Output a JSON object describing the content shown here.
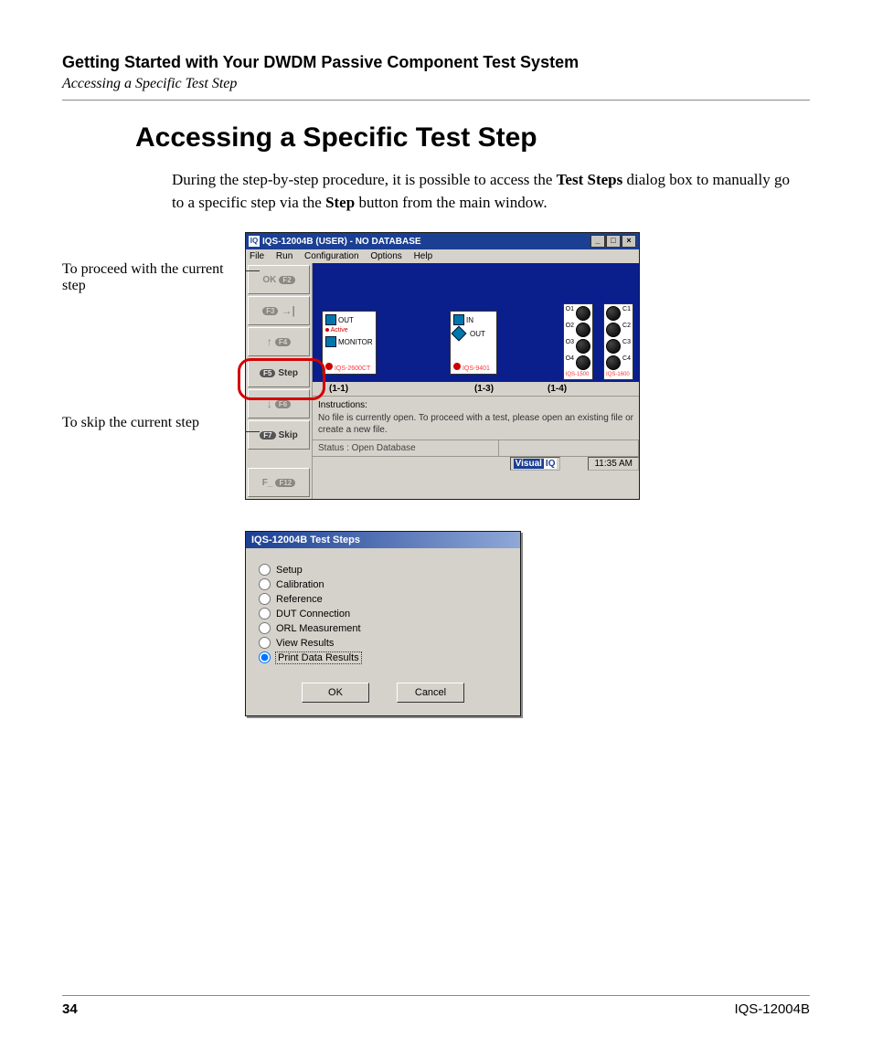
{
  "header": {
    "running_title": "Getting Started with Your DWDM Passive Component Test System",
    "running_sub": "Accessing a Specific Test Step"
  },
  "heading": "Accessing a Specific Test Step",
  "body": {
    "p1_a": "During the step-by-step procedure, it is possible to access the ",
    "p1_b": "Test Steps",
    "p1_c": " dialog box to manually go to a specific step via the ",
    "p1_d": "Step",
    "p1_e": " button from the main window."
  },
  "callout": {
    "proceed": "To proceed with the current step",
    "skip": "To skip the current step"
  },
  "app": {
    "title": "IQS-12004B (USER) - NO DATABASE",
    "menu": {
      "file": "File",
      "run": "Run",
      "config": "Configuration",
      "options": "Options",
      "help": "Help"
    },
    "side": {
      "ok": "OK",
      "f2": "F2",
      "f3": "F3",
      "f4": "F4",
      "step": "Step",
      "f5": "F5",
      "f6": "F6",
      "skip": "Skip",
      "f7": "F7",
      "fblank": "F_",
      "f12": "F12"
    },
    "module1": {
      "out": "OUT",
      "active": "Active",
      "monitor": "MONITOR",
      "foot": "IQS-2600CT"
    },
    "module2": {
      "in": "IN",
      "out": "OUT",
      "foot": "IQS-9401"
    },
    "knobs1": {
      "o1": "O1",
      "o2": "O2",
      "o3": "O3",
      "o4": "O4",
      "foot": "IQS-1500"
    },
    "knobs2": {
      "c1": "C1",
      "c2": "C2",
      "c3": "C3",
      "c4": "C4",
      "foot": "IQS-1600"
    },
    "slots": {
      "s1": "(1-1)",
      "s3": "(1-3)",
      "s4": "(1-4)"
    },
    "instructions": {
      "label": "Instructions:",
      "text": "No file is currently open. To proceed with a test, please open an existing file or create a new file."
    },
    "status": {
      "label": "Status : Open Database"
    },
    "brand": {
      "visual": "Visual",
      "iq": "IQ"
    },
    "time": "11:35 AM"
  },
  "dialog": {
    "title": "IQS-12004B Test Steps",
    "opts": {
      "setup": "Setup",
      "calibration": "Calibration",
      "reference": "Reference",
      "dut": "DUT Connection",
      "orl": "ORL Measurement",
      "view": "View Results",
      "print": "Print Data Results"
    },
    "ok": "OK",
    "cancel": "Cancel"
  },
  "footer": {
    "page": "34",
    "model": "IQS-12004B"
  }
}
